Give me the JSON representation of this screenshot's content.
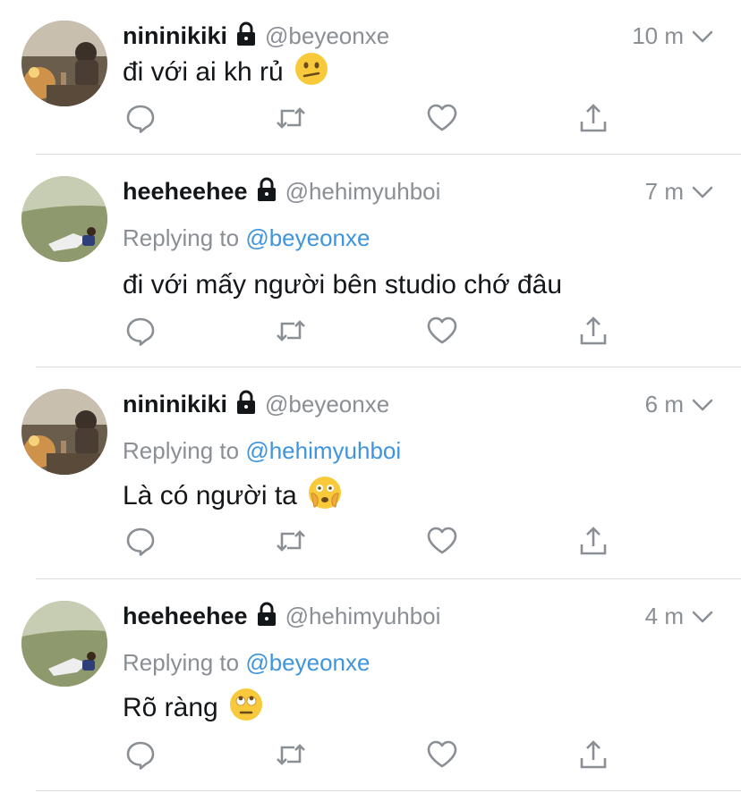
{
  "colors": {
    "text": "#14171a",
    "muted": "#8a8f95",
    "link": "#3f95dd",
    "divider": "#d8dde2",
    "icon": "#8a8f95"
  },
  "replying_prefix": "Replying to ",
  "tweets": [
    {
      "name": "nininikiki",
      "handle": "@beyeonxe",
      "time": "10 m",
      "replying_to": null,
      "text": "đi với ai kh rủ",
      "emoji": "confused-face-emoji"
    },
    {
      "name": "heeheehee",
      "handle": "@hehimyuhboi",
      "time": "7 m",
      "replying_to": "@beyeonxe",
      "text": "đi với mấy người bên studio chớ đâu",
      "emoji": null
    },
    {
      "name": "nininikiki",
      "handle": "@beyeonxe",
      "time": "6 m",
      "replying_to": "@hehimyuhboi",
      "text": "Là có người ta",
      "emoji": "face-with-open-eyes-and-hand-over-mouth-emoji"
    },
    {
      "name": "heeheehee",
      "handle": "@hehimyuhboi",
      "time": "4 m",
      "replying_to": "@beyeonxe",
      "text": "Rõ ràng",
      "emoji": "face-with-rolling-eyes-emoji"
    }
  ],
  "icons": {
    "reply": "reply-icon",
    "retweet": "retweet-icon",
    "like": "heart-icon",
    "share": "share-icon",
    "lock": "lock-icon",
    "caret": "chevron-down-icon"
  }
}
